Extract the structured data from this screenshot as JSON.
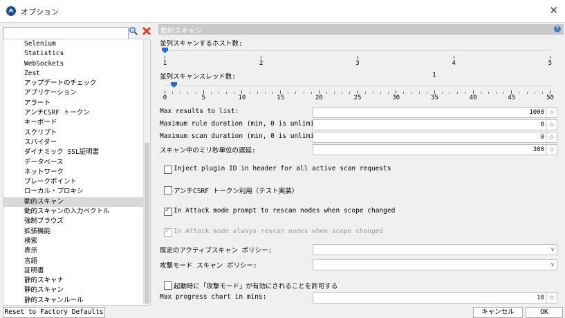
{
  "window": {
    "title": "オプション"
  },
  "tree": {
    "items": [
      "Selenium",
      "Statistics",
      "WebSockets",
      "Zest",
      "アップデートのチェック",
      "アプリケーション",
      "アラート",
      "アンチCSRF トークン",
      "キーボード",
      "スクリプト",
      "スパイダー",
      "ダイナミック SSL証明書",
      "データベース",
      "ネットワーク",
      "ブレークポイント",
      "ローカル・プロキシ",
      "動的スキャン",
      "動的スキャンの入力ベクトル",
      "強制ブラウズ",
      "拡張機能",
      "検索",
      "表示",
      "言語",
      "証明書",
      "静的スキャナ",
      "静的スキャン",
      "静的スキャンルール"
    ],
    "selected_index": 16
  },
  "panel": {
    "title": "動的スキャン",
    "host_slider": {
      "label": "並列スキャンするホスト数:",
      "value": 1,
      "min": 1,
      "max": 5,
      "ticks": [
        "1",
        "2",
        "3",
        "4",
        "5"
      ]
    },
    "thread_slider": {
      "label": "並列スキャンスレッド数:",
      "value": 1,
      "value_label": "1",
      "min": 0,
      "max": 50,
      "ticks": [
        "0",
        "5",
        "10",
        "15",
        "20",
        "25",
        "30",
        "35",
        "40",
        "45",
        "50"
      ]
    },
    "spinners": [
      {
        "label": "Max results to list:",
        "value": "1000"
      },
      {
        "label": "Maximum rule duration (min, 0 is unlimited):",
        "value": "0"
      },
      {
        "label": "Maximum scan duration (min, 0 is unlimited):",
        "value": "0"
      },
      {
        "label": "スキャン中のミリ秒単位の遅延:",
        "value": "300"
      }
    ],
    "checkboxes": [
      {
        "label": "Inject plugin ID in header for all active scan requests",
        "checked": false,
        "disabled": false
      },
      {
        "label": "アンチCSRF トークン利用（テスト実装）",
        "checked": false,
        "disabled": false
      },
      {
        "label": "In Attack mode prompt to rescan nodes when scope changed",
        "checked": true,
        "disabled": false
      },
      {
        "label": "In Attack mode always rescan nodes when scope changed",
        "checked": true,
        "disabled": true
      }
    ],
    "default_policy": {
      "label": "既定のアクティブスキャン ポリシー:",
      "value": ""
    },
    "attack_policy": {
      "label": "攻撃モード スキャン ポリシー:",
      "value": ""
    },
    "allow_attack_on_start": {
      "label": "起動時に「攻撃モード」が有効にされることを許可する",
      "checked": false
    },
    "progress_chart": {
      "label": "Max progress chart in mins:",
      "value": "10"
    }
  },
  "buttons": {
    "reset": "Reset to Factory Defaults",
    "cancel": "キャンセル",
    "ok": "OK"
  },
  "colors": {
    "accent": "#1a6fd6",
    "header": "#c9c9c9",
    "selected": "#d9d9d9",
    "clear": "#e03c1f"
  }
}
